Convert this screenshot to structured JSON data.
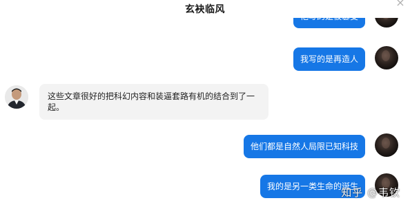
{
  "header": {
    "title": "玄袂临风",
    "close_icon": "close-icon"
  },
  "messages": [
    {
      "sender": "self",
      "text": "他写的是被篡变"
    },
    {
      "sender": "self",
      "text": "我写的是再造人"
    },
    {
      "sender": "other",
      "text": "这些文章很好的把科幻内容和装逼套路有机的结合到了一起。"
    },
    {
      "sender": "self",
      "text": "他们都是自然人局限已知科技"
    },
    {
      "sender": "self",
      "text": "我的是另一类生命的诞生"
    }
  ],
  "watermark": "知乎 @韦钦",
  "colors": {
    "outgoing_bubble": "#1677e6",
    "incoming_bubble": "#f3f3f3",
    "background": "#ffffff"
  }
}
